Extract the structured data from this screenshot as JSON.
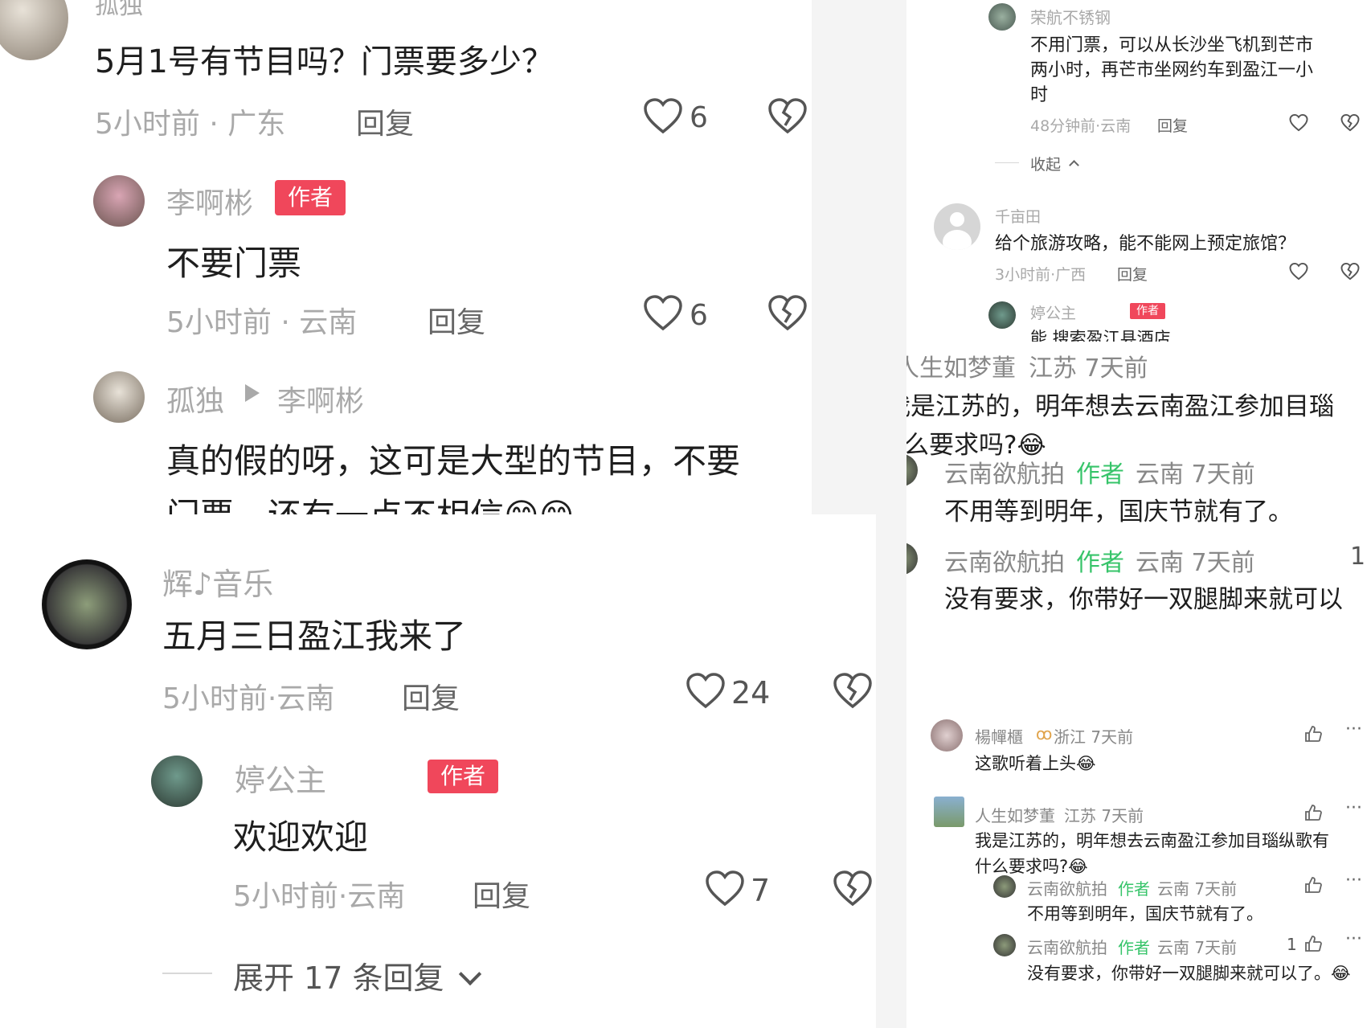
{
  "left_top": {
    "c1": {
      "user": "孤独",
      "text": "5月1号有节目吗？门票要多少？",
      "time": "5小时前 · 广东",
      "reply": "回复",
      "likes": "6"
    },
    "c2": {
      "user": "李啊彬",
      "tag": "作者",
      "text": "不要门票",
      "time": "5小时前 · 云南",
      "reply": "回复",
      "likes": "6"
    },
    "c3": {
      "user": "孤独",
      "to": "李啊彬",
      "text1": "真的假的呀，这可是大型的节目，不要",
      "text2": "门票，还有一点不相信😁😁"
    }
  },
  "left_bottom": {
    "c1": {
      "user": "辉♪音乐",
      "text": "五月三日盈江我来了",
      "time": "5小时前·云南",
      "reply": "回复",
      "likes": "24"
    },
    "c2": {
      "user": "婷公主",
      "tag": "作者",
      "text": "欢迎欢迎",
      "time": "5小时前·云南",
      "reply": "回复",
      "likes": "7"
    },
    "expand": "展开 17 条回复"
  },
  "right_1": {
    "c1": {
      "user": "荣航不锈钢",
      "text1": "不用门票，可以从长沙坐飞机到芒市",
      "text2": "两小时，再芒市坐网约车到盈江一小",
      "text3": "时",
      "time": "48分钟前·云南",
      "reply": "回复"
    },
    "collapse": "收起",
    "c2": {
      "user": "千亩田",
      "text": "给个旅游攻略，能不能网上预定旅馆？",
      "time": "3小时前·广西",
      "reply": "回复"
    },
    "c3": {
      "user": "婷公主",
      "tag": "作者",
      "text": "能 搜索盈江县酒店"
    }
  },
  "right_2": {
    "c1": {
      "user": "人生如梦董",
      "meta": "江苏 7天前",
      "text1": "我是江苏的，明年想去云南盈江参加目瑙",
      "text2": "什么要求吗?😂"
    },
    "c2": {
      "user": "云南欲航拍",
      "tag": "作者",
      "meta": "云南 7天前",
      "text": "不用等到明年，国庆节就有了。"
    },
    "c3": {
      "user": "云南欲航拍",
      "tag": "作者",
      "meta": "云南 7天前",
      "likes": "1",
      "text": "没有要求，你带好一双腿脚来就可以"
    }
  },
  "right_3": {
    "c1": {
      "user": "楊幝櫃",
      "meta": "浙江 7天前",
      "text": "这歌听着上头😂"
    },
    "c2": {
      "user": "人生如梦董",
      "meta": "江苏 7天前",
      "text1": "我是江苏的，明年想去云南盈江参加目瑙纵歌有",
      "text2": "什么要求吗?😂"
    },
    "c3": {
      "user": "云南欲航拍",
      "tag": "作者",
      "meta": "云南 7天前",
      "text": "不用等到明年，国庆节就有了。"
    },
    "c4": {
      "user": "云南欲航拍",
      "tag": "作者",
      "meta": "云南 7天前",
      "likes": "1",
      "text": "没有要求，你带好一双腿脚来就可以了。😂"
    }
  },
  "colors": {
    "tag_red": "#f0475b",
    "author_green": "#37c46a",
    "meta_gray": "#a9a9a9",
    "text": "#1e1e1e"
  },
  "icons": [
    "heart-icon",
    "broken-heart-icon",
    "thumbs-up-icon",
    "more-icon",
    "chevron-down-icon",
    "chevron-up-icon",
    "avatar"
  ]
}
